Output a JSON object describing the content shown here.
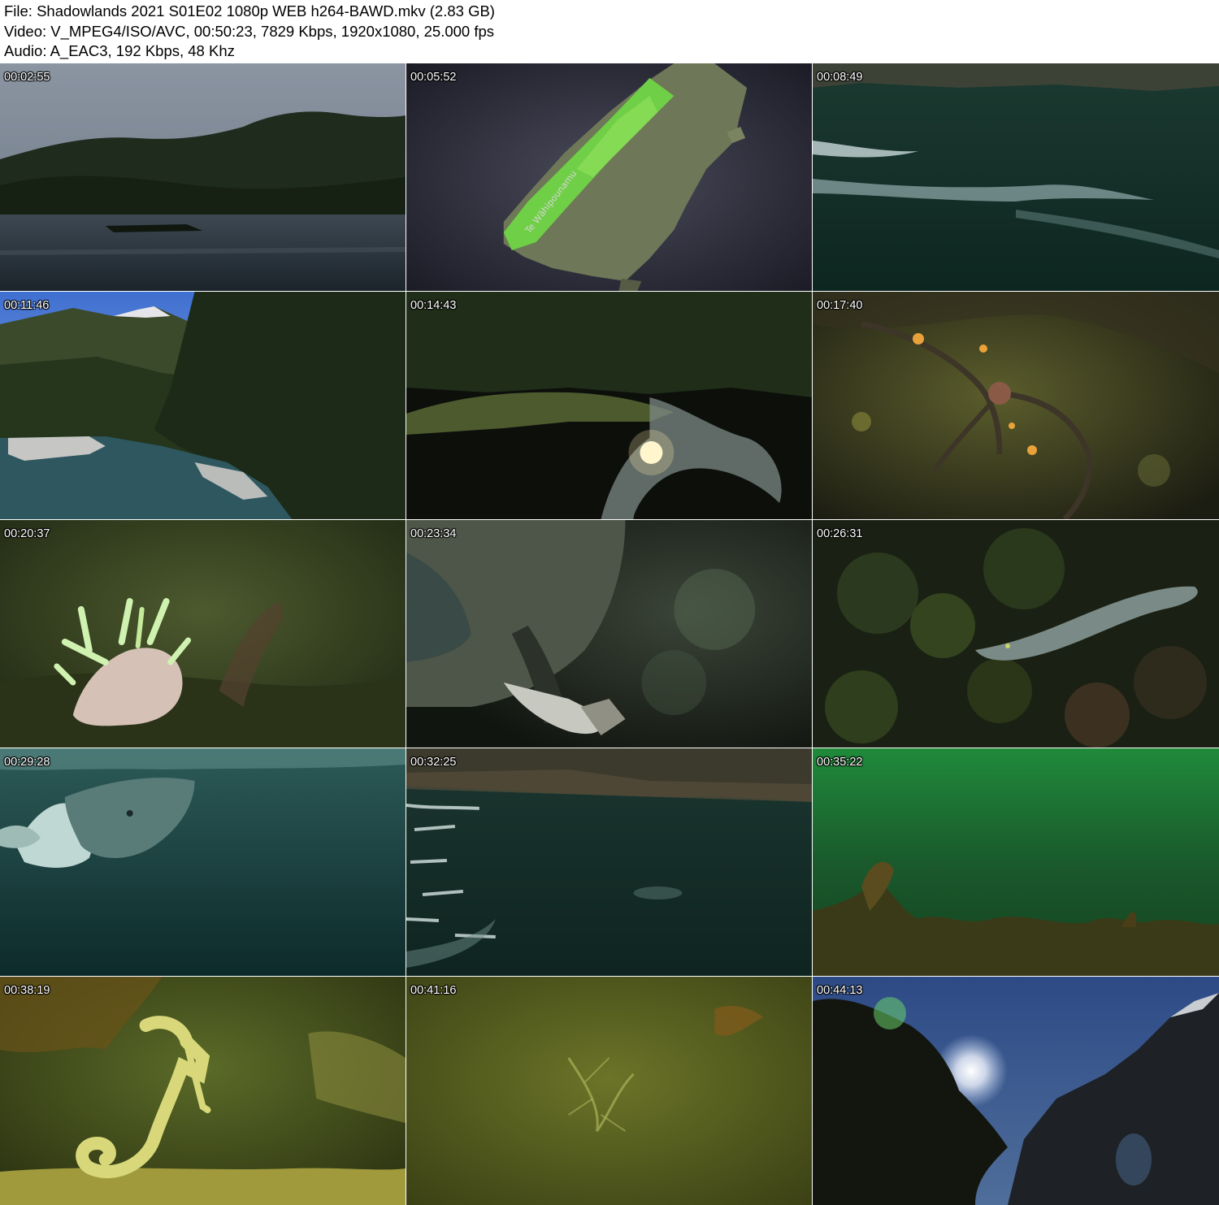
{
  "header": {
    "file_line": "File: Shadowlands 2021 S01E02 1080p WEB h264-BAWD.mkv (2.83 GB)",
    "video_line": "Video: V_MPEG4/ISO/AVC, 00:50:23, 7829 Kbps, 1920x1080, 25.000 fps",
    "audio_line": "Audio: A_EAC3, 192 Kbps, 48 Khz"
  },
  "thumbnails": [
    {
      "timestamp": "00:02:55",
      "scene": "fiord-forested-hills"
    },
    {
      "timestamp": "00:05:52",
      "scene": "map-south-island",
      "map_label": "Te Wāhipounamu"
    },
    {
      "timestamp": "00:08:49",
      "scene": "dark-water-wake"
    },
    {
      "timestamp": "00:11:46",
      "scene": "river-valley-forest"
    },
    {
      "timestamp": "00:14:43",
      "scene": "lake-reflection"
    },
    {
      "timestamp": "00:17:40",
      "scene": "brittle-star-reef"
    },
    {
      "timestamp": "00:20:37",
      "scene": "sea-slug"
    },
    {
      "timestamp": "00:23:34",
      "scene": "kea-parrot"
    },
    {
      "timestamp": "00:26:31",
      "scene": "eel-rocks"
    },
    {
      "timestamp": "00:29:28",
      "scene": "dolphins-underwater"
    },
    {
      "timestamp": "00:32:25",
      "scene": "cliff-water"
    },
    {
      "timestamp": "00:35:22",
      "scene": "green-water-kelp"
    },
    {
      "timestamp": "00:38:19",
      "scene": "seahorse"
    },
    {
      "timestamp": "00:41:16",
      "scene": "murky-green-water"
    },
    {
      "timestamp": "00:44:13",
      "scene": "sun-through-trees"
    }
  ]
}
